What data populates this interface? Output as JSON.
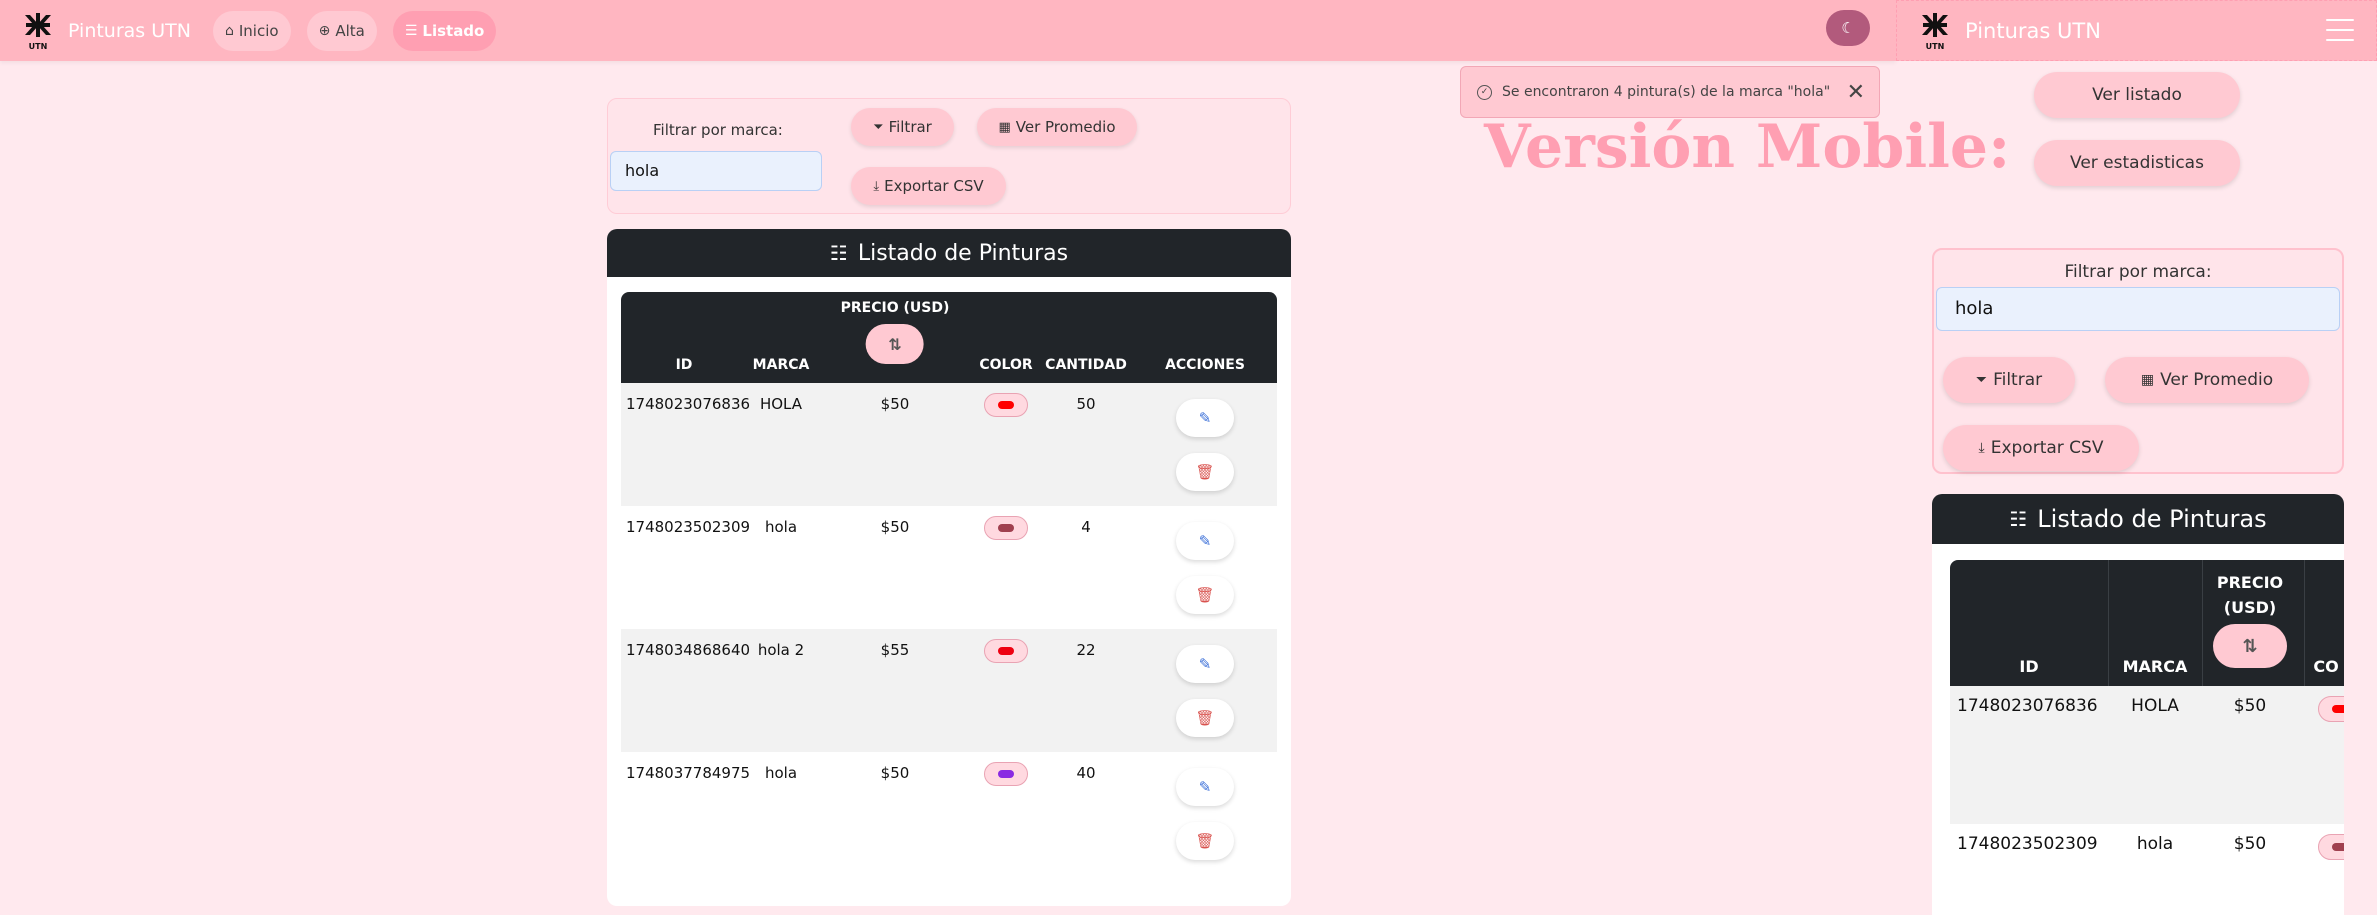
{
  "navbar": {
    "brand": "Pinturas UTN",
    "links": [
      {
        "label": "Inicio",
        "icon": "home-icon"
      },
      {
        "label": "Alta",
        "icon": "plus-circle-icon"
      },
      {
        "label": "Listado",
        "icon": "list-icon",
        "active": true
      }
    ],
    "theme_toggle_icon": "moon-icon"
  },
  "toast": {
    "message": "Se encontraron 4 pintura(s) de la marca \"hola\""
  },
  "mobile_label": "Versión Mobile:",
  "filter": {
    "label": "Filtrar por marca:",
    "value": "hola",
    "filter_button": "Filtrar",
    "average_button": "Ver Promedio",
    "export_button": "Exportar CSV"
  },
  "list": {
    "title": "Listado de Pinturas",
    "columns": {
      "id": "ID",
      "marca": "MARCA",
      "precio": "PRECIO (USD)",
      "color": "COLOR",
      "cantidad": "CANTIDAD",
      "acciones": "ACCIONES"
    },
    "rows": [
      {
        "id": "1748023076836",
        "marca": "HOLA",
        "precio": "$50",
        "color": "#ff0000",
        "cantidad": "50"
      },
      {
        "id": "1748023502309",
        "marca": "hola",
        "precio": "$50",
        "color": "#a0404f",
        "cantidad": "4"
      },
      {
        "id": "1748034868640",
        "marca": "hola 2",
        "precio": "$55",
        "color": "#ee0011",
        "cantidad": "22"
      },
      {
        "id": "1748037784975",
        "marca": "hola",
        "precio": "$50",
        "color": "#8a2be2",
        "cantidad": "40"
      }
    ]
  },
  "mobile": {
    "brand": "Pinturas UTN",
    "menu_buttons": [
      "Ver listado",
      "Ver estadisticas"
    ],
    "filter": {
      "label": "Filtrar por marca:",
      "value": "hola",
      "filter_button": "Filtrar",
      "average_button": "Ver Promedio",
      "export_button": "Exportar CSV"
    },
    "list": {
      "title": "Listado de Pinturas",
      "columns": {
        "id": "ID",
        "marca": "MARCA",
        "precio_1": "PRECIO",
        "precio_2": "(USD)",
        "color": "CO"
      },
      "rows": [
        {
          "id": "1748023076836",
          "marca": "HOLA",
          "precio": "$50",
          "color": "#ff0000"
        },
        {
          "id": "1748023502309",
          "marca": "hola",
          "precio": "$50",
          "color": "#a0404f"
        }
      ]
    }
  }
}
